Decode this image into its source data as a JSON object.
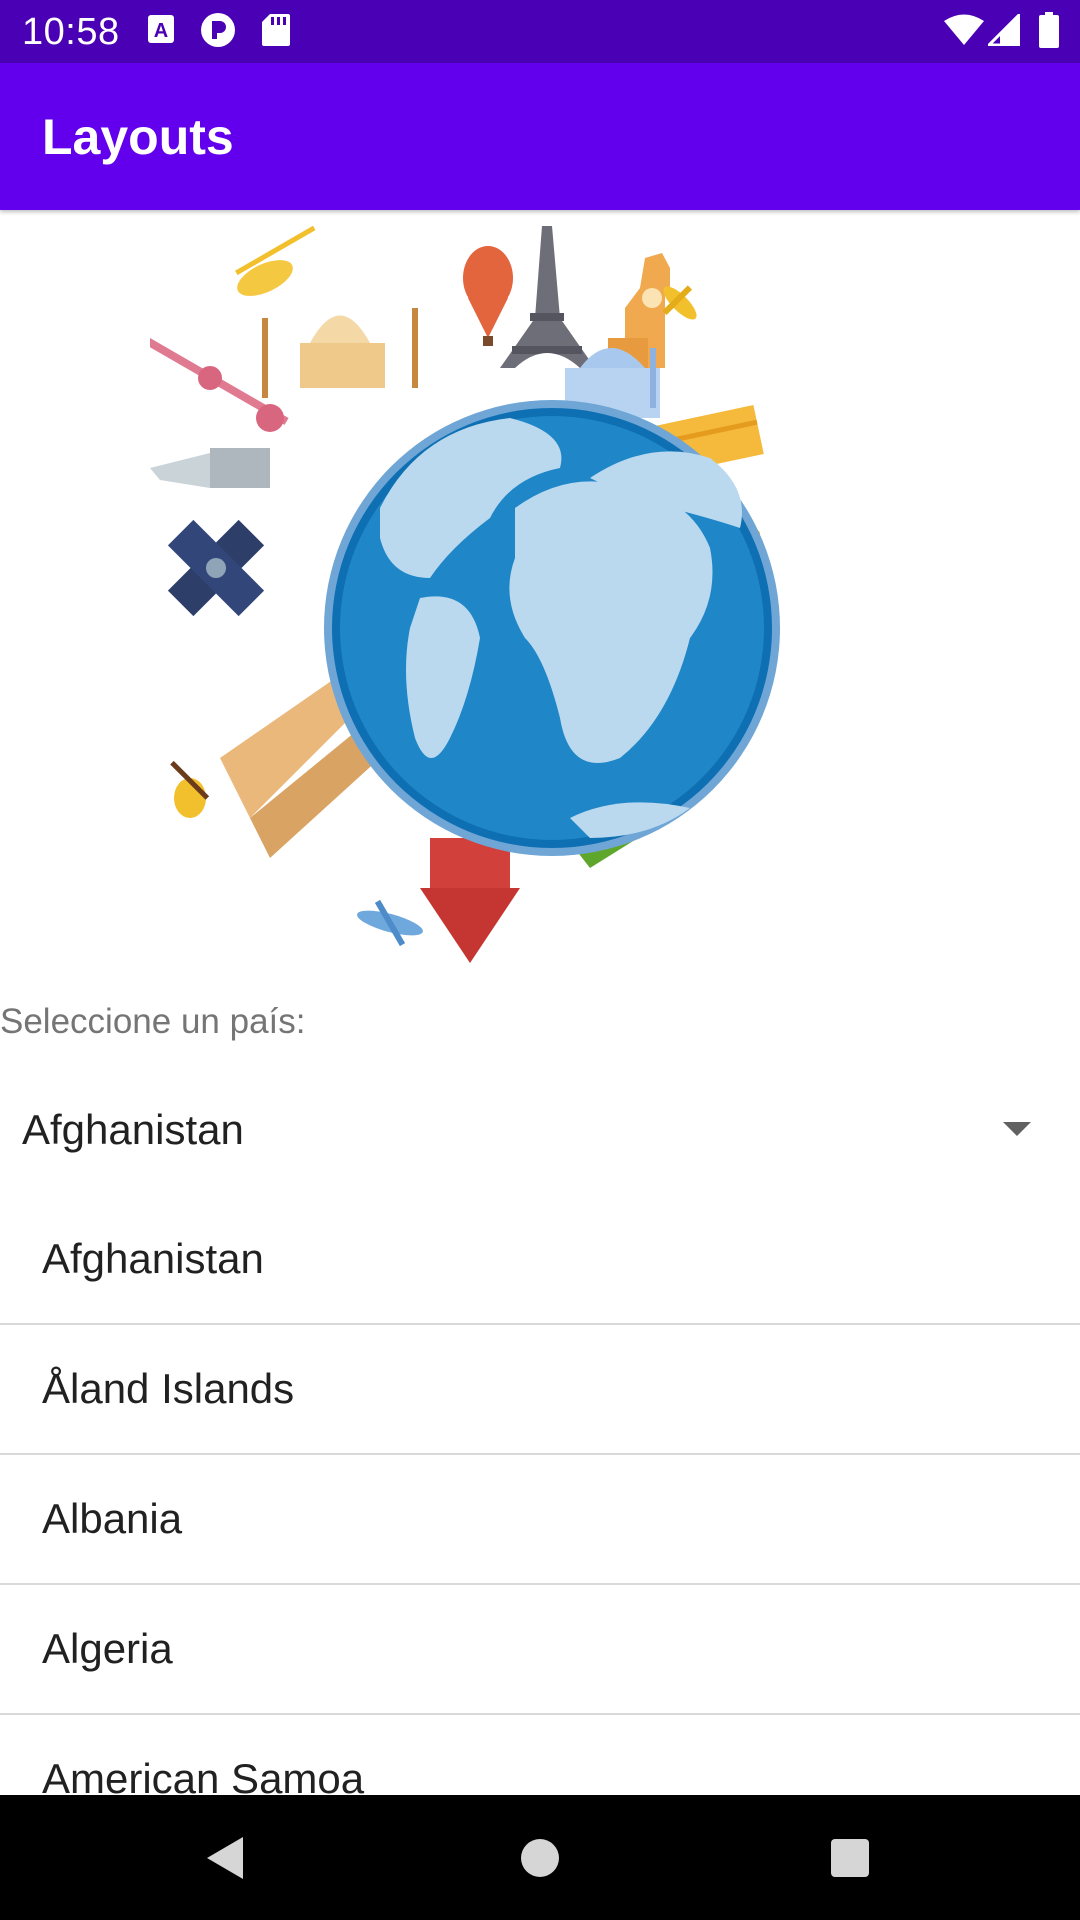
{
  "status_bar": {
    "time": "10:58",
    "background": "#4a00b4",
    "left_icons": [
      "text-a-icon",
      "privacy-dot-icon",
      "sd-card-icon"
    ],
    "right_icons": [
      "wifi-icon",
      "signal-icon",
      "battery-icon"
    ]
  },
  "app_bar": {
    "title": "Layouts",
    "background": "#6200ee"
  },
  "hero": {
    "icon": "world-travel-illustration-icon"
  },
  "form": {
    "prompt": "Seleccione un país:",
    "spinner_value": "Afghanistan",
    "spinner_icon": "dropdown-arrow-icon"
  },
  "country_list": {
    "items": [
      {
        "label": "Afghanistan"
      },
      {
        "label": "Åland Islands"
      },
      {
        "label": "Albania"
      },
      {
        "label": "Algeria"
      },
      {
        "label": "American Samoa"
      }
    ]
  },
  "nav_bar": {
    "buttons": [
      "back-icon",
      "home-icon",
      "recents-icon"
    ]
  }
}
